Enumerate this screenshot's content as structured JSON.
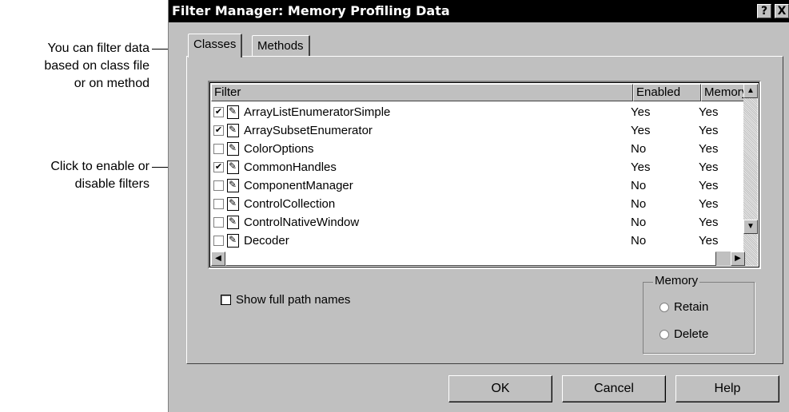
{
  "callouts": {
    "one": [
      "You can filter data",
      "based on class file",
      "or on method"
    ],
    "two": [
      "Click to enable or",
      "disable filters"
    ]
  },
  "dialog": {
    "title": "Filter Manager: Memory Profiling Data",
    "help_btn": "?",
    "close_btn": "X"
  },
  "tabs": {
    "classes": "Classes",
    "methods": "Methods"
  },
  "list": {
    "headers": [
      "Filter",
      "Enabled",
      "Memory"
    ],
    "rows": [
      {
        "name": "ArrayListEnumeratorSimple",
        "enabled": "Yes",
        "memory": "Yes",
        "checked": true
      },
      {
        "name": "ArraySubsetEnumerator",
        "enabled": "Yes",
        "memory": "Yes",
        "checked": true
      },
      {
        "name": "ColorOptions",
        "enabled": "No",
        "memory": "Yes",
        "checked": false
      },
      {
        "name": "CommonHandles",
        "enabled": "Yes",
        "memory": "Yes",
        "checked": true
      },
      {
        "name": "ComponentManager",
        "enabled": "No",
        "memory": "Yes",
        "checked": false
      },
      {
        "name": "ControlCollection",
        "enabled": "No",
        "memory": "Yes",
        "checked": false
      },
      {
        "name": "ControlNativeWindow",
        "enabled": "No",
        "memory": "Yes",
        "checked": false
      },
      {
        "name": "Decoder",
        "enabled": "No",
        "memory": "Yes",
        "checked": false
      }
    ]
  },
  "options": {
    "show_full_path": "Show full path names"
  },
  "memory_group": {
    "title": "Memory",
    "retain": "Retain",
    "delete": "Delete"
  },
  "buttons": {
    "ok": "OK",
    "cancel": "Cancel",
    "help": "Help"
  }
}
